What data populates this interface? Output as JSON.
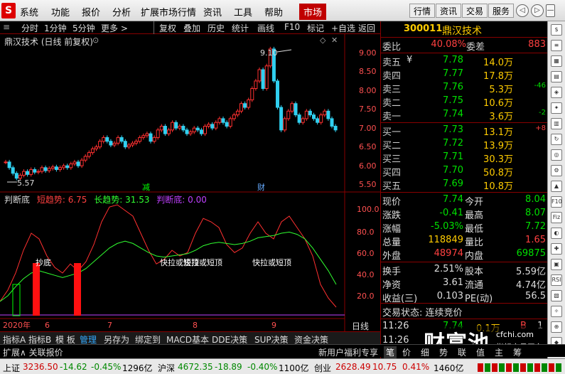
{
  "menu": {
    "logo": "S",
    "items": [
      "系统",
      "功能",
      "报价",
      "分析",
      "扩展市场行情",
      "资讯",
      "工具",
      "帮助"
    ],
    "active": "市场"
  },
  "rbtns": [
    "行情",
    "资讯",
    "交易",
    "服务"
  ],
  "circles": [
    "◁",
    "▷",
    "—",
    "□",
    "✕"
  ],
  "toolbar": [
    "分时",
    "1分钟",
    "5分钟",
    "更多 >",
    "复权",
    "叠加",
    "历史",
    "统计",
    "画线",
    "F10",
    "标记",
    "+自选",
    "返回"
  ],
  "chart": {
    "title": "鼎汉技术 (日线 前复权)",
    "high_label": "9.10",
    "low_label": "5.57",
    "price_axis": [
      "9.00",
      "8.50",
      "8.00",
      "7.50",
      "7.00",
      "6.50",
      "6.00",
      "5.50"
    ],
    "markers": {
      "jian": "减",
      "cai": "财"
    },
    "indicator_name": "判断底",
    "indicator_values": {
      "short": "短趋势: 6.75",
      "long": "长趋势: 31.53",
      "judge": "判断底: 0.00"
    },
    "indicator_axis": [
      "100.0",
      "80.0",
      "60.0",
      "40.0",
      "20.0"
    ],
    "annotations": {
      "chaodi": "抄底",
      "kuai1": "快拉或短顶",
      "kuai2": "快拉或短顶",
      "kuai3": "快拉或短顶"
    },
    "date_labels": {
      "year": "2020年",
      "m6": "6",
      "m7": "7",
      "m8": "8",
      "m9": "9"
    },
    "period": "日线"
  },
  "stock": {
    "code": "300011",
    "name": "鼎汉技术"
  },
  "orderbook": {
    "weibi_label": "委比",
    "weibi": "40.08%",
    "weicha_label": "委差",
    "weicha": "883",
    "asks": [
      {
        "label": "卖五",
        "mark": "¥",
        "price": "7.78",
        "vol": "14.0万",
        "chg": ""
      },
      {
        "label": "卖四",
        "mark": "",
        "price": "7.77",
        "vol": "17.8万",
        "chg": ""
      },
      {
        "label": "卖三",
        "mark": "",
        "price": "7.76",
        "vol": "5.3万",
        "chg": "-46"
      },
      {
        "label": "卖二",
        "mark": "",
        "price": "7.75",
        "vol": "10.6万",
        "chg": ""
      },
      {
        "label": "卖一",
        "mark": "",
        "price": "7.74",
        "vol": "3.6万",
        "chg": "-2"
      }
    ],
    "bids": [
      {
        "label": "买一",
        "price": "7.73",
        "vol": "13.1万",
        "chg": "+8"
      },
      {
        "label": "买二",
        "price": "7.72",
        "vol": "13.9万",
        "chg": ""
      },
      {
        "label": "买三",
        "price": "7.71",
        "vol": "30.3万",
        "chg": ""
      },
      {
        "label": "买四",
        "price": "7.70",
        "vol": "50.8万",
        "chg": ""
      },
      {
        "label": "买五",
        "price": "7.69",
        "vol": "10.8万",
        "chg": ""
      }
    ]
  },
  "quote": [
    {
      "l1": "现价",
      "v1": "7.74",
      "c1": "dn",
      "l2": "今开",
      "v2": "8.04",
      "c2": "dn"
    },
    {
      "l1": "涨跌",
      "v1": "-0.41",
      "c1": "dn",
      "l2": "最高",
      "v2": "8.07",
      "c2": "dn"
    },
    {
      "l1": "涨幅",
      "v1": "-5.03%",
      "c1": "dn",
      "l2": "最低",
      "v2": "7.72",
      "c2": "dn"
    },
    {
      "l1": "总量",
      "v1": "118849",
      "c1": "yl",
      "l2": "量比",
      "v2": "1.65",
      "c2": "up"
    },
    {
      "l1": "外盘",
      "v1": "48974",
      "c1": "up",
      "l2": "内盘",
      "v2": "69875",
      "c2": "dn"
    }
  ],
  "fund": [
    {
      "l1": "换手",
      "v1": "2.51%",
      "l2": "股本",
      "v2": "5.59亿"
    },
    {
      "l1": "净资",
      "v1": "3.61",
      "l2": "流通",
      "v2": "4.74亿"
    },
    {
      "l1": "收益(三)",
      "v1": "0.103",
      "l2": "PE(动)",
      "v2": "56.5"
    }
  ],
  "trade_status": "交易状态: 连续竞价",
  "ticks": [
    {
      "time": "11:26",
      "price": "7.74",
      "vol": "0.1万",
      "flag": "B",
      "n": "1"
    },
    {
      "time": "11:26",
      "price": "",
      "vol": "",
      "flag": "",
      "n": ""
    }
  ],
  "watermark": {
    "big": "财富池",
    "site": "cfchi.com",
    "sub": "指标交易平台"
  },
  "tabs": [
    "指标A",
    "指标B",
    "模 板",
    "管理",
    "另存为",
    "绑定到",
    "MACD基本",
    "DDE决策",
    "SUP决策",
    "资金决策"
  ],
  "tabs2": {
    "left": "扩展∧  关联报价",
    "right": [
      "新用户福利专享",
      "笔",
      "价",
      "细",
      "势",
      "联",
      "值",
      "主",
      "筹"
    ]
  },
  "status": {
    "sh": "上证",
    "sh_v": "3236.50",
    "sh_c": "-14.62",
    "sh_p": "-0.45%",
    "sh_a": "1296亿",
    "hs": "沪深",
    "hs_v": "4672.35",
    "hs_c": "-18.89",
    "hs_p": "-0.40%",
    "hs_a": "1100亿",
    "cy": "创业",
    "cy_v": "2628.49",
    "cy_c": "10.75",
    "cy_p": "0.41%",
    "cy_a": "1460亿"
  },
  "colors": {
    "up": "#ff4040",
    "down": "#00e000",
    "accent": "#c00000",
    "yellow": "#ffcc00"
  }
}
